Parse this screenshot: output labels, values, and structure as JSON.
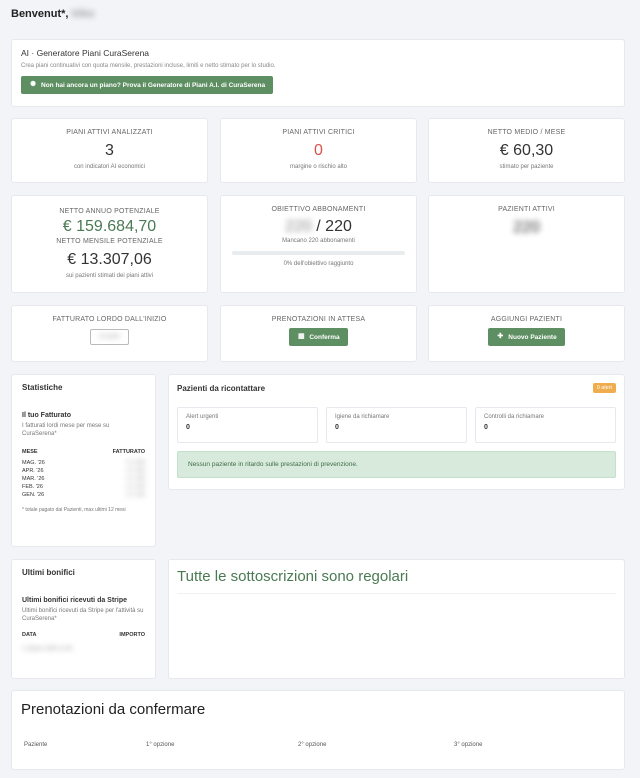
{
  "greeting": {
    "text": "Benvenut*,",
    "name": "Mike"
  },
  "ai": {
    "title": "AI · Generatore Piani CuraSerena",
    "desc": "Crea piani continuativi con quota mensile, prestazioni incluse, limiti e netto stimato per lo studio.",
    "button": "Non hai ancora un piano? Prova il Generatore di Piani A.I. di CuraSerena"
  },
  "stats": {
    "analyzed": {
      "label": "PIANI ATTIVI ANALIZZATI",
      "value": "3",
      "sub": "con indicatori AI economici"
    },
    "critical": {
      "label": "PIANI ATTIVI CRITICI",
      "value": "0",
      "sub": "margine o rischio alto"
    },
    "net_avg": {
      "label": "NETTO MEDIO / MESE",
      "value": "€ 60,30",
      "sub": "stimato per paziente"
    }
  },
  "potential": {
    "annual_label": "NETTO ANNUO POTENZIALE",
    "annual_value": "€ 159.684,70",
    "monthly_label": "NETTO MENSILE POTENZIALE",
    "monthly_value": "€ 13.307,06",
    "sub": "sui pazienti stimati dei piani attivi"
  },
  "goal": {
    "label": "OBIETTIVO ABBONAMENTI",
    "current": "220",
    "target": "/ 220",
    "missing": "Mancano 220 abbonamenti",
    "progress_text": "0% dell'obiettivo raggiunto",
    "progress": 0
  },
  "patients_active": {
    "label": "PAZIENTI ATTIVI",
    "value": "220"
  },
  "revenue": {
    "label": "FATTURATO LORDO DALL'INIZIO",
    "value": "€ 6.800"
  },
  "bookings": {
    "label": "PRENOTAZIONI IN ATTESA",
    "button": "Conferma"
  },
  "add_patients": {
    "label": "AGGIUNGI PAZIENTI",
    "button": "Nuovo Paziente"
  },
  "statistics": {
    "title": "Statistiche",
    "subtitle": "Il tuo Fatturato",
    "desc": "I fatturati lordi mese per mese su CuraSerena*",
    "col_month": "MESE",
    "col_revenue": "FATTURATO",
    "rows": [
      {
        "month": "MAG. '26",
        "value": "€ 1.200"
      },
      {
        "month": "APR. '26",
        "value": "€ 1.100"
      },
      {
        "month": "MAR. '26",
        "value": "€ 1.150"
      },
      {
        "month": "FEB. '26",
        "value": "€ 1.130"
      },
      {
        "month": "GEN. '26",
        "value": "€ 1.120"
      }
    ],
    "note": "* totale pagato dai Pazienti, max ultimi 12 mesi"
  },
  "recontact": {
    "title": "Pazienti da ricontattare",
    "badge": "0 alert",
    "boxes": [
      {
        "label": "Alert urgenti",
        "value": "0"
      },
      {
        "label": "Igiene da richiamare",
        "value": "0"
      },
      {
        "label": "Controlli da richiamare",
        "value": "0"
      }
    ],
    "banner": "Nessun paziente in ritardo sulle prestazioni di prevenzione."
  },
  "transfers": {
    "title": "Ultimi bonifici",
    "subtitle": "Ultimi bonifici ricevuti da Stripe",
    "desc": "Ultimi bonifici ricevuti da Stripe per l'attività su CuraSerena*",
    "col_date": "DATA",
    "col_amount": "IMPORTO",
    "row": "1 ottobre 2025 11:05"
  },
  "subscriptions": {
    "title": "Tutte le sottoscrizioni sono regolari"
  },
  "pending": {
    "title": "Prenotazioni da confermare",
    "cols": [
      "Paziente",
      "1° opzione",
      "2° opzione",
      "3° opzione"
    ]
  }
}
